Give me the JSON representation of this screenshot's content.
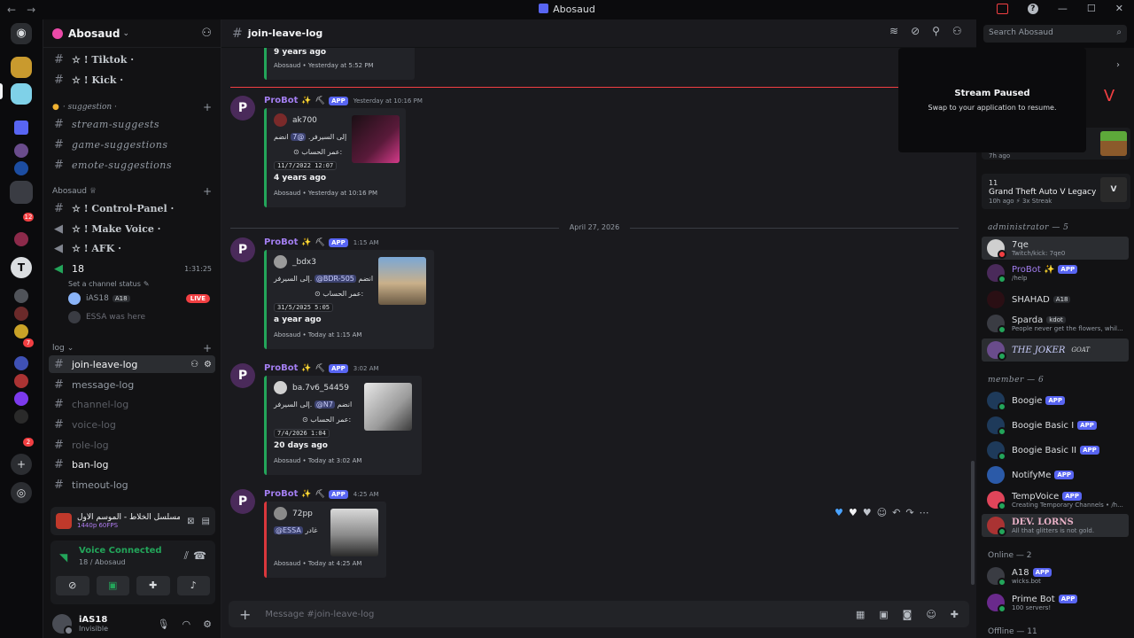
{
  "window": {
    "title": "Abosaud"
  },
  "rail": {
    "badges": [
      "12",
      "7",
      "2"
    ]
  },
  "server": {
    "name": "Abosaud"
  },
  "channels": {
    "top": [
      {
        "label": "☆ ! Tiktok ·"
      },
      {
        "label": "☆ ! Kick ·"
      }
    ],
    "cat_suggestion": "· suggestion ·",
    "suggestion_items": [
      {
        "label": "stream-suggests"
      },
      {
        "label": "game-suggestions"
      },
      {
        "label": "emote-suggestions"
      }
    ],
    "cat_abosaud": "Abosaud ♕",
    "abosaud_items": [
      {
        "label": "☆ ! Control-Panel ·"
      },
      {
        "label": "☆ ! Make Voice ·"
      },
      {
        "label": "☆ ! AFK ·"
      }
    ],
    "voice": {
      "name": "18",
      "timer": "1:31:25",
      "status": "Set a channel status",
      "users": [
        {
          "name": "iAS18",
          "tag": "A18",
          "live": "LIVE"
        },
        {
          "name": "ESSA was here"
        }
      ]
    },
    "cat_log": "log",
    "log_items": [
      {
        "label": "join-leave-log"
      },
      {
        "label": "message-log"
      },
      {
        "label": "channel-log"
      },
      {
        "label": "voice-log"
      },
      {
        "label": "role-log"
      },
      {
        "label": "ban-log"
      },
      {
        "label": "timeout-log"
      }
    ]
  },
  "now_playing": {
    "title": "مسلسل الخلاط - الموسم الأول - Ep#1 ...",
    "quality": "1440p 60FPS"
  },
  "voice_panel": {
    "status": "Voice Connected",
    "sub": "18 / Abosaud"
  },
  "user": {
    "name": "iAS18",
    "status": "Invisible"
  },
  "chat": {
    "channel": "join-leave-log",
    "search_placeholder": "Search Abosaud",
    "composer_placeholder": "Message #join-leave-log",
    "date_separator": "April 27, 2026",
    "top_partial": {
      "ago": "9 years ago",
      "footer": "Abosaud • Yesterday at 5:52 PM"
    },
    "messages": [
      {
        "author": "ProBot",
        "app": "APP",
        "time": "Yesterday at 10:16 PM",
        "user": "ak700",
        "joined_prefix": "انضم",
        "joined_mention": "@7",
        "joined_suffix": "إلى السيرفر.",
        "age_label": "عمر الحساب:",
        "date": "11/7/2022 12:07",
        "ago": "4 years ago",
        "footer": "Abosaud • Yesterday at 10:16 PM"
      },
      {
        "author": "ProBot",
        "app": "APP",
        "time": "1:15 AM",
        "user": "_bdx3",
        "joined_prefix": "انضم",
        "joined_mention": "@BDR-505",
        "joined_suffix": "إلى السيرفر.",
        "age_label": "عمر الحساب:",
        "date": "31/5/2025 5:05",
        "ago": "a year ago",
        "footer": "Abosaud • Today at 1:15 AM"
      },
      {
        "author": "ProBot",
        "app": "APP",
        "time": "3:02 AM",
        "user": "ba.7v6_54459",
        "joined_prefix": "انضم",
        "joined_mention": "@N7",
        "joined_suffix": "إلى السيرفر.",
        "age_label": "عمر الحساب:",
        "date": "7/4/2026 1:04",
        "ago": "20 days ago",
        "footer": "Abosaud • Today at 3:02 AM"
      },
      {
        "author": "ProBot",
        "app": "APP",
        "time": "4:25 AM",
        "user": "72pp",
        "left_mention": "@ESSA",
        "left_text": "غادر",
        "footer": "Abosaud • Today at 4:25 AM"
      }
    ]
  },
  "stream_toast": {
    "title": "Stream Paused",
    "body": "Swap to your application to resume."
  },
  "members": {
    "game1": {
      "line1": "7h ago"
    },
    "game2": {
      "count": "11",
      "title": "Grand Theft Auto V Legacy",
      "meta": "10h ago ⚡ 3x Streak"
    },
    "admin_header": "administrator — 5",
    "admins": [
      {
        "name": "7qe",
        "sub": "Twitch/kick: 7qe0"
      },
      {
        "name": "ProBot ✨",
        "tag": "APP",
        "sub": "/help"
      },
      {
        "name": "SHAHAD",
        "tag": "A18"
      },
      {
        "name": "Sparda",
        "tag": "kdot",
        "sub": "People never get the flowers, whil..."
      },
      {
        "name": "THE JOKER",
        "tag": "GOAT"
      }
    ],
    "member_header": "member — 6",
    "members": [
      {
        "name": "Boogie",
        "tag": "APP"
      },
      {
        "name": "Boogie Basic I",
        "tag": "APP"
      },
      {
        "name": "Boogie Basic II",
        "tag": "APP"
      },
      {
        "name": "NotifyMe",
        "tag": "APP"
      },
      {
        "name": "TempVoice",
        "tag": "APP",
        "sub": "Creating Temporary Channels • /h..."
      },
      {
        "name": "DEV. LORNS",
        "sub": "All that glitters is not gold."
      }
    ],
    "online_header": "Online — 2",
    "online": [
      {
        "name": "A18",
        "tag": "APP",
        "sub": "wicks.bot"
      },
      {
        "name": "Prime Bot",
        "tag": "APP",
        "sub": "100 servers!"
      }
    ],
    "offline_header": "Offline — 11"
  }
}
